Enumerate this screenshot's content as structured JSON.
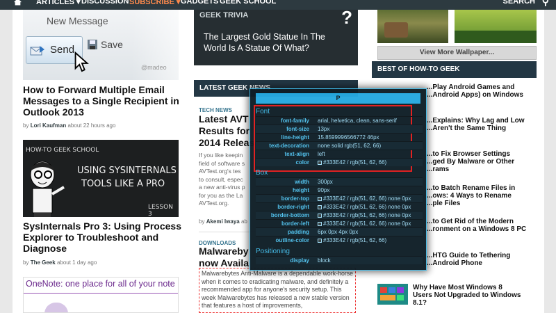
{
  "nav": {
    "items": [
      "ARTICLES ▾",
      "DISCUSSION",
      "SUBSCRIBE ▾",
      "GADGETS",
      "GEEK SCHOOL"
    ],
    "search": "SEARCH"
  },
  "left": {
    "thumb1": {
      "new_message": "New Message",
      "send": "Send",
      "save": "Save",
      "email": "@madeo"
    },
    "article1": {
      "title": "How to Forward Multiple Email Messages to a Single Recipient in Outlook 2013",
      "by": "by",
      "author": "Lori Kaufman",
      "time": "about 22 hours ago"
    },
    "thumb2": {
      "school": "HOW-TO GEEK SCHOOL",
      "line1": "USING SYSINTERNALS",
      "line2": "TOOLS LIKE A PRO",
      "lesson": "LESSON 3"
    },
    "article2": {
      "title": "SysInternals Pro 3: Using Process Explorer to Troubleshoot and Diagnose",
      "by": "by",
      "author": "The Geek",
      "time": "about 1 day ago"
    },
    "thumb3": {
      "text": "OneNote: one place for all of your note"
    }
  },
  "middle": {
    "trivia": {
      "heading": "GEEK TRIVIA",
      "mark": "?",
      "question": "The Largest Gold Statue In The World Is A Statue Of What?"
    },
    "latest": "LATEST GEEK NEWS",
    "news1": {
      "tag": "TECH NEWS",
      "title": [
        "Latest AVT",
        "Results for",
        "2014 Releas"
      ],
      "body": [
        "If you like keepin",
        "field of software s",
        "AVTest.org's tes",
        "to consult, espec",
        "a new anti-virus p",
        "for you as the La",
        "AVTest.org."
      ],
      "by": "by",
      "author": "Akemi Iwaya",
      "time": "ab"
    },
    "news2": {
      "tag": "DOWNLOADS",
      "title": [
        "Malwareby",
        "now Availa"
      ],
      "body": "Malwarebytes Anti-Malware is a dependable work-horse when it comes to eradicating malware, and definitely a recommended app for anyone's security setup. This week Malwarebytes has released a new stable version that features a host of improvements,"
    }
  },
  "right": {
    "view_more": "View More Wallpaper...",
    "best": "BEST OF HOW-TO GEEK",
    "items": [
      [
        "...Play Android Games and",
        "...Android Apps) on Windows"
      ],
      [
        "...Explains: Why Lag and Low",
        "...Aren't the Same Thing"
      ],
      [
        "...to Fix Browser Settings",
        "...ged By Malware or Other",
        "...rams"
      ],
      [
        "...to Batch Rename Files in",
        "...ows: 4 Ways to Rename",
        "...ple Files"
      ],
      [
        "...to Get Rid of the Modern",
        "...ronment on a Windows 8 PC"
      ],
      [
        "...HTG Guide to Tethering",
        "...Android Phone"
      ],
      [
        "Why Have Most Windows 8",
        "Users Not Upgraded to Windows",
        "8.1?"
      ]
    ]
  },
  "inspector": {
    "tag": "P",
    "sections": {
      "font": "Font",
      "box": "Box",
      "positioning": "Positioning"
    },
    "font_rows": [
      {
        "k": "font-family",
        "v": "arial, helvetica, clean, sans-serif"
      },
      {
        "k": "font-size",
        "v": "13px"
      },
      {
        "k": "line-height",
        "v": "15.8599996566772 46px"
      },
      {
        "k": "text-decoration",
        "v": "none solid rgb(51, 62, 66)"
      },
      {
        "k": "text-align",
        "v": "left"
      },
      {
        "k": "color",
        "v": "#333E42 / rgb(51, 62, 66)"
      }
    ],
    "box_rows": [
      {
        "k": "width",
        "v": "300px"
      },
      {
        "k": "height",
        "v": "90px"
      },
      {
        "k": "border-top",
        "v": "#333E42 / rgb(51, 62, 66) none 0px"
      },
      {
        "k": "border-right",
        "v": "#333E42 / rgb(51, 62, 66) none 0px"
      },
      {
        "k": "border-bottom",
        "v": "#333E42 / rgb(51, 62, 66) none 0px"
      },
      {
        "k": "border-left",
        "v": "#333E42 / rgb(51, 62, 66) none 0px"
      },
      {
        "k": "padding",
        "v": "6px 0px 4px 0px"
      },
      {
        "k": "outline-color",
        "v": "#333E42 / rgb(51, 62, 66)"
      }
    ],
    "pos_rows": [
      {
        "k": "display",
        "v": "block"
      }
    ]
  }
}
